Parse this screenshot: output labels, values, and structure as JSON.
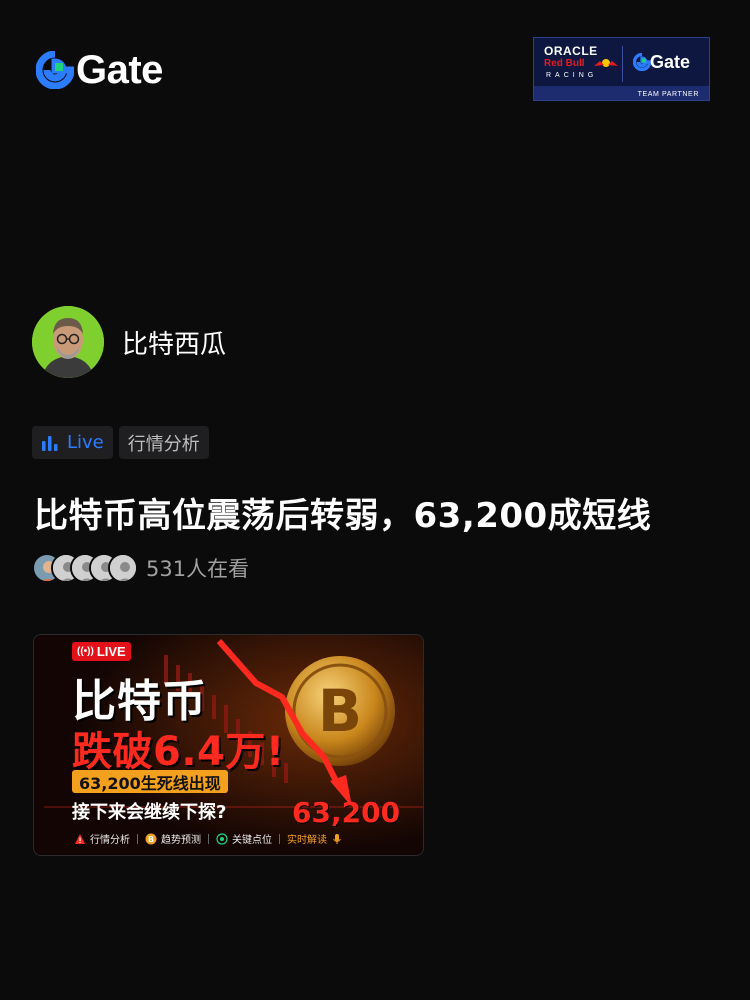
{
  "header": {
    "brand_name": "Gate",
    "partner": {
      "oracle": "ORACLE",
      "redbull": "Red Bull",
      "racing": "RACING",
      "gate": "Gate",
      "team_partner": "TEAM PARTNER"
    }
  },
  "author": {
    "name": "比特西瓜"
  },
  "tags": {
    "live_label": "Live",
    "category": "行情分析"
  },
  "post": {
    "title": "比特币高位震荡后转弱，63,200成短线",
    "viewers_text": "531人在看"
  },
  "thumbnail": {
    "live_badge": "LIVE",
    "headline": "比特币",
    "subheadline": "跌破6.4万!",
    "band_text": "63,200生死线出现",
    "question": "接下来会继续下探?",
    "price": "63,200",
    "footer": [
      "行情分析",
      "趋势预测",
      "关键点位",
      "实时解读"
    ]
  },
  "colors": {
    "background": "#0b0b0c",
    "accent_blue": "#2c7cff",
    "brand_green": "#1fd37a",
    "alert_red": "#ff2a1f",
    "band_orange": "#f2a01e"
  }
}
